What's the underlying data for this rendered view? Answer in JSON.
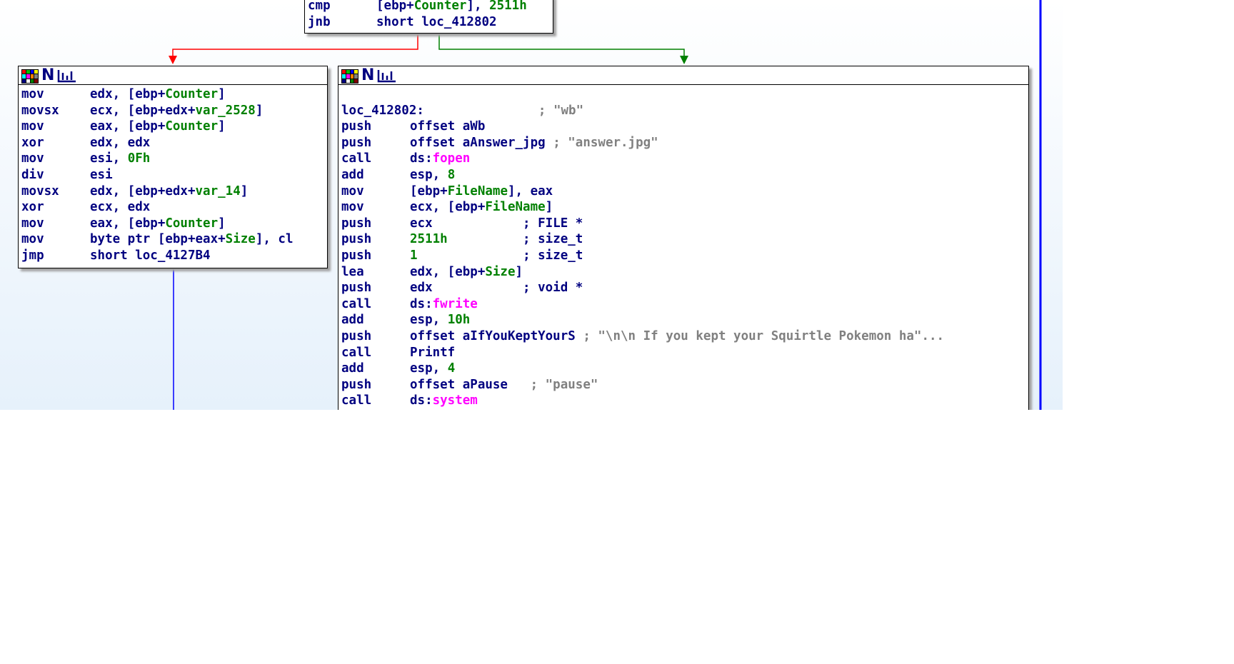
{
  "top_block": {
    "lines": [
      {
        "mn": "cmp",
        "ops": [
          {
            "t": "[ebp+"
          },
          {
            "t": "Counter",
            "c": "g"
          },
          {
            "t": "], "
          },
          {
            "t": "2511h",
            "c": "g"
          }
        ]
      },
      {
        "mn": "jnb",
        "ops": [
          {
            "t": "short loc_412802"
          }
        ]
      }
    ]
  },
  "left_block": {
    "header_icons": [
      "color-grid-icon",
      "n-icon",
      "graph-icon"
    ],
    "lines": [
      {
        "mn": "mov",
        "ops": [
          {
            "t": "edx, [ebp+"
          },
          {
            "t": "Counter",
            "c": "g"
          },
          {
            "t": "]"
          }
        ]
      },
      {
        "mn": "movsx",
        "ops": [
          {
            "t": "ecx, [ebp+edx+"
          },
          {
            "t": "var_2528",
            "c": "g"
          },
          {
            "t": "]"
          }
        ]
      },
      {
        "mn": "mov",
        "ops": [
          {
            "t": "eax, [ebp+"
          },
          {
            "t": "Counter",
            "c": "g"
          },
          {
            "t": "]"
          }
        ]
      },
      {
        "mn": "xor",
        "ops": [
          {
            "t": "edx, edx"
          }
        ]
      },
      {
        "mn": "mov",
        "ops": [
          {
            "t": "esi, "
          },
          {
            "t": "0Fh",
            "c": "g"
          }
        ]
      },
      {
        "mn": "div",
        "ops": [
          {
            "t": "esi"
          }
        ]
      },
      {
        "mn": "movsx",
        "ops": [
          {
            "t": "edx, [ebp+edx+"
          },
          {
            "t": "var_14",
            "c": "g"
          },
          {
            "t": "]"
          }
        ]
      },
      {
        "mn": "xor",
        "ops": [
          {
            "t": "ecx, edx"
          }
        ]
      },
      {
        "mn": "mov",
        "ops": [
          {
            "t": "eax, [ebp+"
          },
          {
            "t": "Counter",
            "c": "g"
          },
          {
            "t": "]"
          }
        ]
      },
      {
        "mn": "mov",
        "ops": [
          {
            "t": "byte ptr [ebp+eax+"
          },
          {
            "t": "Size",
            "c": "g"
          },
          {
            "t": "], cl"
          }
        ]
      },
      {
        "mn": "jmp",
        "ops": [
          {
            "t": "short loc_4127B4"
          }
        ]
      }
    ]
  },
  "right_block": {
    "header_icons": [
      "color-grid-icon",
      "n-icon",
      "graph-icon"
    ],
    "label": "loc_412802:",
    "label_comment": "; \"wb\"",
    "lines": [
      {
        "mn": "push",
        "ops": [
          {
            "t": "offset aWb"
          }
        ]
      },
      {
        "mn": "push",
        "ops": [
          {
            "t": "offset aAnswer_jpg "
          },
          {
            "t": "; \"answer.jpg\"",
            "c": "c"
          }
        ]
      },
      {
        "mn": "call",
        "ops": [
          {
            "t": "ds:"
          },
          {
            "t": "fopen",
            "c": "m"
          }
        ]
      },
      {
        "mn": "add",
        "ops": [
          {
            "t": "esp, "
          },
          {
            "t": "8",
            "c": "g"
          }
        ]
      },
      {
        "mn": "mov",
        "ops": [
          {
            "t": "[ebp+"
          },
          {
            "t": "FileName",
            "c": "g"
          },
          {
            "t": "], eax"
          }
        ]
      },
      {
        "mn": "mov",
        "ops": [
          {
            "t": "ecx, [ebp+"
          },
          {
            "t": "FileName",
            "c": "g"
          },
          {
            "t": "]"
          }
        ]
      },
      {
        "mn": "push",
        "ops": [
          {
            "t": "ecx            "
          },
          {
            "t": "; FILE *"
          }
        ]
      },
      {
        "mn": "push",
        "ops": [
          {
            "t": "2511h",
            "c": "g"
          },
          {
            "t": "          "
          },
          {
            "t": "; size_t"
          }
        ]
      },
      {
        "mn": "push",
        "ops": [
          {
            "t": "1",
            "c": "g"
          },
          {
            "t": "              "
          },
          {
            "t": "; size_t"
          }
        ]
      },
      {
        "mn": "lea",
        "ops": [
          {
            "t": "edx, [ebp+"
          },
          {
            "t": "Size",
            "c": "g"
          },
          {
            "t": "]"
          }
        ]
      },
      {
        "mn": "push",
        "ops": [
          {
            "t": "edx            "
          },
          {
            "t": "; void *"
          }
        ]
      },
      {
        "mn": "call",
        "ops": [
          {
            "t": "ds:"
          },
          {
            "t": "fwrite",
            "c": "m"
          }
        ]
      },
      {
        "mn": "add",
        "ops": [
          {
            "t": "esp, "
          },
          {
            "t": "10h",
            "c": "g"
          }
        ]
      },
      {
        "mn": "push",
        "ops": [
          {
            "t": "offset aIfYouKeptYourS "
          },
          {
            "t": "; \"\\n\\n If you kept your Squirtle Pokemon ha\"...",
            "c": "c"
          }
        ]
      },
      {
        "mn": "call",
        "ops": [
          {
            "t": "Printf"
          }
        ]
      },
      {
        "mn": "add",
        "ops": [
          {
            "t": "esp, "
          },
          {
            "t": "4",
            "c": "g"
          }
        ]
      },
      {
        "mn": "push",
        "ops": [
          {
            "t": "offset aPause   "
          },
          {
            "t": "; \"pause\"",
            "c": "c"
          }
        ]
      },
      {
        "mn": "call",
        "ops": [
          {
            "t": "ds:"
          },
          {
            "t": "system",
            "c": "m"
          }
        ]
      }
    ]
  },
  "colors": {
    "mnemonic": "#000080",
    "variable": "#008000",
    "import": "#ff00ff",
    "comment": "#808080",
    "edge_false": "#ff0000",
    "edge_true": "#008000",
    "edge_jump": "#0000ff"
  }
}
